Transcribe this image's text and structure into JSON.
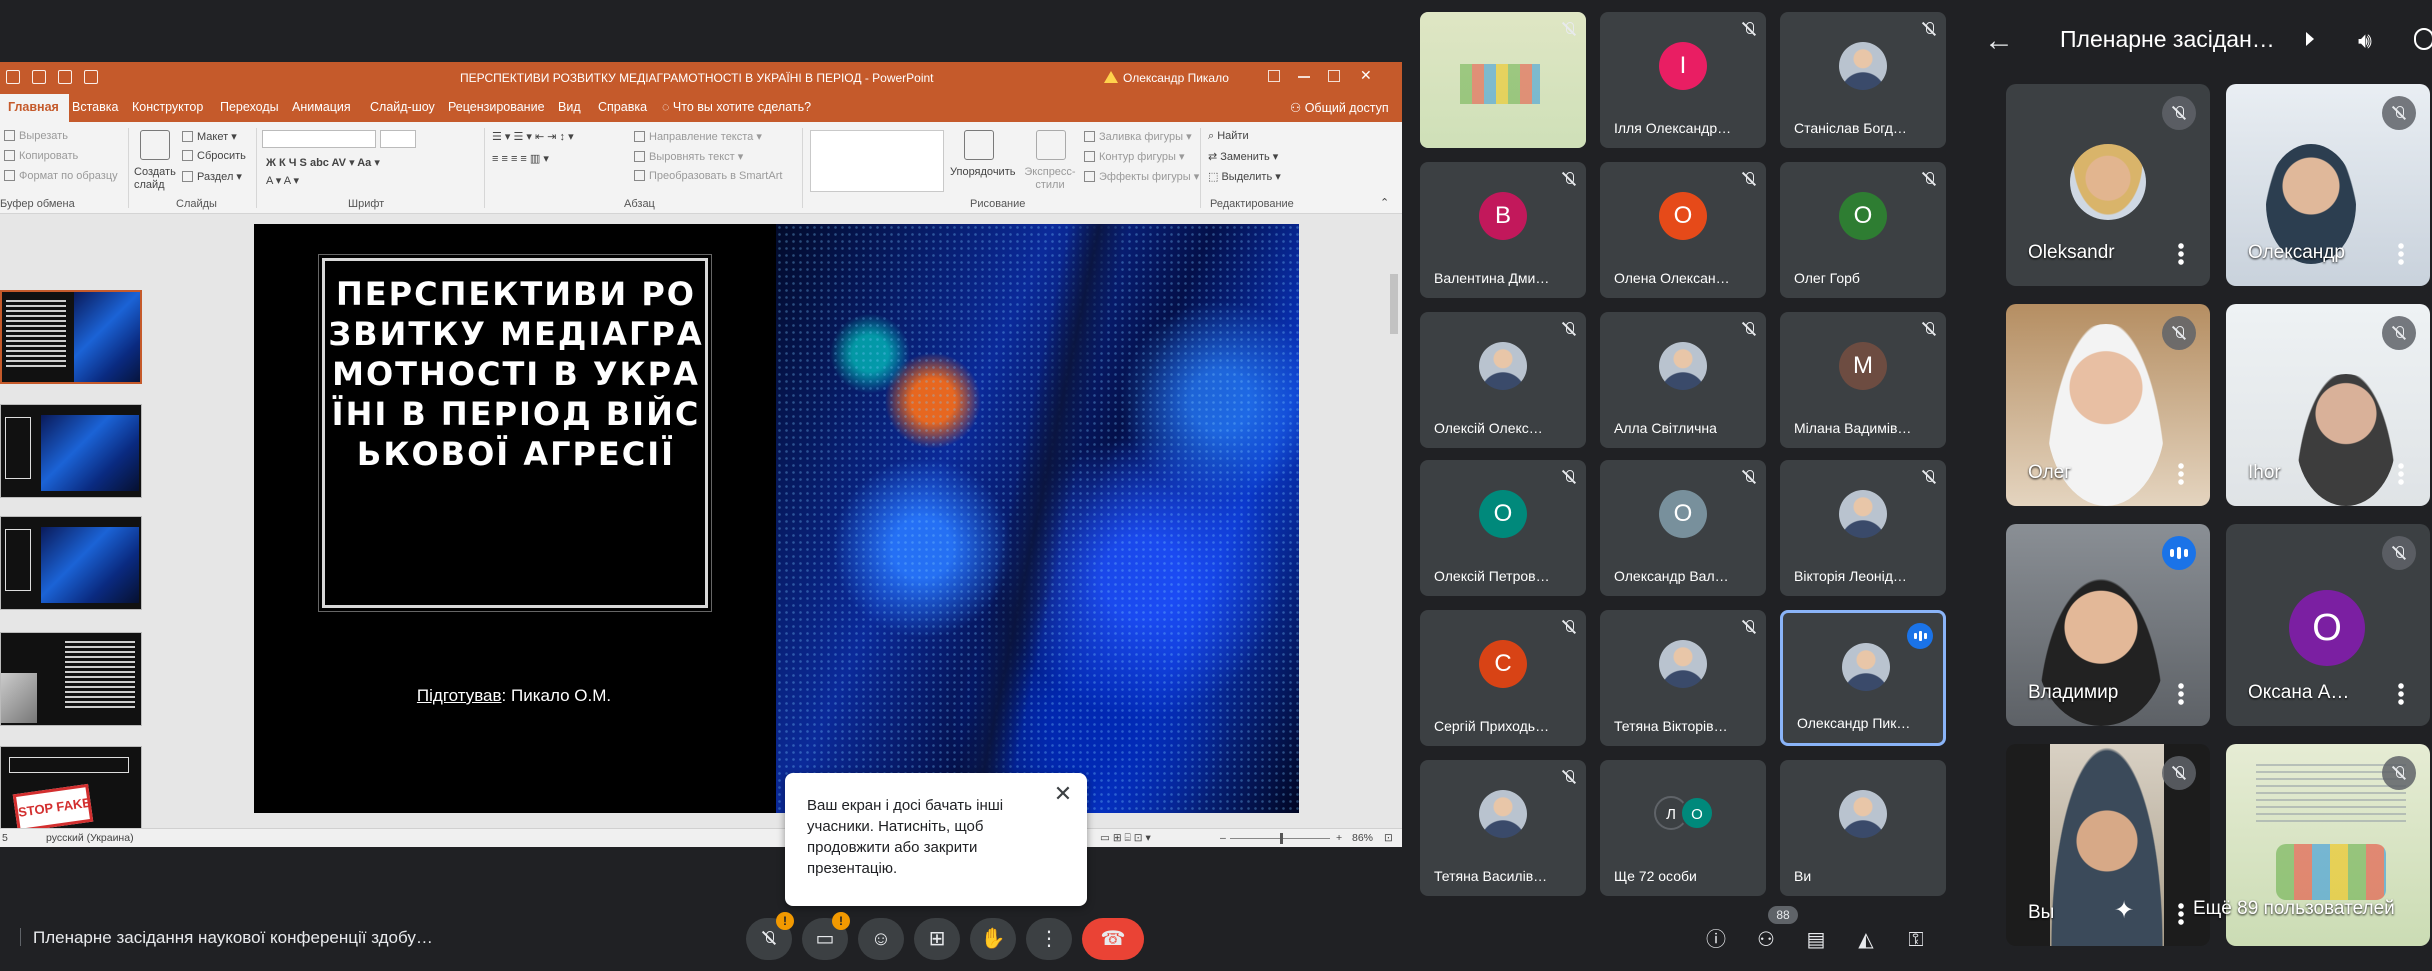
{
  "ppt": {
    "doc_title": "ПЕРСПЕКТИВИ РОЗВИТКУ МЕДІАГРАМОТНОСТІ В УКРАЇНІ В ПЕРІОД  -  PowerPoint",
    "user": "Олександр Пикало",
    "tabs": [
      "Главная",
      "Вставка",
      "Конструктор",
      "Переходы",
      "Анимация",
      "Слайд-шоу",
      "Рецензирование",
      "Вид",
      "Справка",
      "Что вы хотите сделать?"
    ],
    "share": "Общий доступ",
    "ribbon": {
      "clipboard": [
        "Вырезать",
        "Копировать",
        "Формат по образцу"
      ],
      "clipboard_group": "Буфер обмена",
      "new_slide": "Создать слайд",
      "layout": "Макет",
      "reset": "Сбросить",
      "section": "Раздел",
      "slides_group": "Слайды",
      "font_group": "Шрифт",
      "paragraph": [
        "Направление текста",
        "Выровнять текст",
        "Преобразовать в SmartArt"
      ],
      "paragraph_group": "Абзац",
      "arrange": "Упорядочить",
      "express_styles": "Экспресс-стили",
      "drawing": [
        "Заливка фигуры",
        "Контур фигуры",
        "Эффекты фигуры"
      ],
      "drawing_group": "Рисование",
      "editing": [
        "Найти",
        "Заменить",
        "Выделить"
      ],
      "editing_group": "Редактирование"
    },
    "slide": {
      "title": "ПЕРСПЕКТИВИ РОЗВИТКУ МЕДІАГРАМОТНОСТІ В УКРАЇНІ В ПЕРІОД ВІЙСЬКОВОЇ АГРЕСІЇ",
      "author_label": "Підготував",
      "author_name": ": Пикало О.М."
    },
    "thumb_stop": "STOP FAKE",
    "status": {
      "slide_no": "5",
      "language": "русский (Украина)",
      "zoom": "86%"
    }
  },
  "toast": {
    "text": "Ваш екран і досі бачать інші учасники. Натисніть, щоб продовжити або закрити презентацію."
  },
  "meeting": {
    "name": "Пленарне засідання наукової конференції здобу…",
    "badge_mic": "!",
    "badge_cam": "!",
    "people_count": "88"
  },
  "grid": [
    {
      "name": "",
      "type": "screen"
    },
    {
      "name": "Ілля Олександр…",
      "initial": "І",
      "color": "#e91e63"
    },
    {
      "name": "Станіслав Богд…",
      "type": "photo"
    },
    {
      "name": "Валентина Дми…",
      "initial": "В",
      "color": "#c2185b"
    },
    {
      "name": "Олена Олексан…",
      "initial": "О",
      "color": "#e64a19"
    },
    {
      "name": "Олег Горб",
      "initial": "О",
      "color": "#2e7d32"
    },
    {
      "name": "Олексій Олекс…",
      "type": "photo"
    },
    {
      "name": "Алла Світлична",
      "type": "photo"
    },
    {
      "name": "Мілана Вадимів…",
      "initial": "М",
      "color": "#6d4c41"
    },
    {
      "name": "Олексій Петров…",
      "initial": "О",
      "color": "#00897b"
    },
    {
      "name": "Олександр Вал…",
      "initial": "О",
      "color": "#78909c"
    },
    {
      "name": "Вікторія Леонід…",
      "type": "photo"
    },
    {
      "name": "Сергій Приходь…",
      "initial": "С",
      "color": "#d84315"
    },
    {
      "name": "Тетяна Вікторів…",
      "type": "photo"
    },
    {
      "name": "Олександр Пик…",
      "type": "photo",
      "speaking": true
    },
    {
      "name": "Тетяна Василів…",
      "type": "photo"
    },
    {
      "name": "Ще 72 особи",
      "type": "more",
      "initials": [
        "Л",
        "О"
      ]
    },
    {
      "name": "Ви",
      "type": "photo"
    }
  ],
  "phone": {
    "title": "Пленарне засідан…",
    "tiles": [
      "Oleksandr",
      "Олександр",
      "Олег",
      "Ihor",
      "Владимир",
      "Оксана А…",
      "Вы",
      ""
    ],
    "oksana_initial": "О",
    "more": "Ещё 89 пользователей"
  }
}
